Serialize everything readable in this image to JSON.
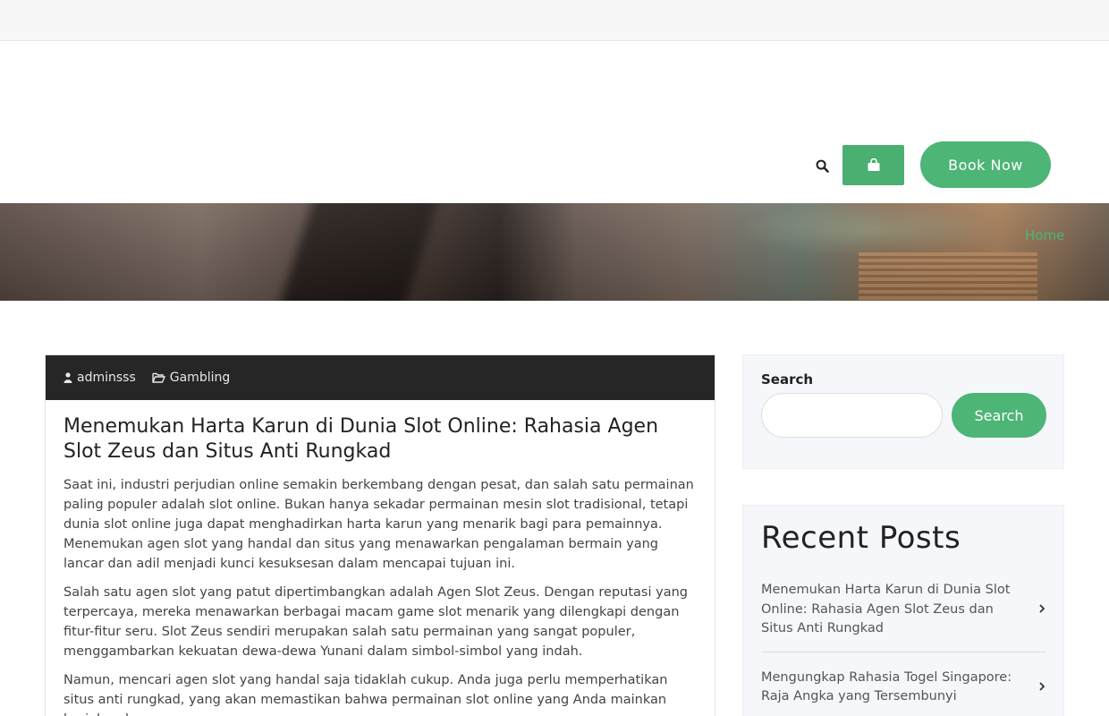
{
  "header": {
    "search_icon": "search-icon",
    "cart_icon": "shopping-bag-icon",
    "book_now_label": "Book Now",
    "accent_color": "#4db576"
  },
  "breadcrumb": {
    "home_label": "Home"
  },
  "post": {
    "author": "adminsss",
    "category": "Gambling",
    "title": "Menemukan Harta Karun di Dunia Slot Online: Rahasia Agen Slot Zeus dan Situs Anti Rungkad",
    "paragraphs": [
      "Saat ini, industri perjudian online semakin berkembang dengan pesat, dan salah satu permainan paling populer adalah slot online. Bukan hanya sekadar permainan mesin slot tradisional, tetapi dunia slot online juga dapat menghadirkan harta karun yang menarik bagi para pemainnya. Menemukan agen slot yang handal dan situs yang menawarkan pengalaman bermain yang lancar dan adil menjadi kunci kesuksesan dalam mencapai tujuan ini.",
      "Salah satu agen slot yang patut dipertimbangkan adalah Agen Slot Zeus. Dengan reputasi yang terpercaya, mereka menawarkan berbagai macam game slot menarik yang dilengkapi dengan fitur-fitur seru. Slot Zeus sendiri merupakan salah satu permainan yang sangat populer, menggambarkan kekuatan dewa-dewa Yunani dalam simbol-simbol yang indah.",
      "Namun, mencari agen slot yang handal saja tidaklah cukup. Anda juga perlu memperhatikan situs anti rungkad, yang akan memastikan bahwa permainan slot online yang Anda mainkan berjalan dengan"
    ]
  },
  "sidebar": {
    "search": {
      "label": "Search",
      "placeholder": "",
      "button_label": "Search"
    },
    "recent": {
      "heading": "Recent Posts",
      "items": [
        {
          "title": "Menemukan Harta Karun di Dunia Slot Online: Rahasia Agen Slot Zeus dan Situs Anti Rungkad"
        },
        {
          "title": "Mengungkap Rahasia Togel Singapore: Raja Angka yang Tersembunyi"
        }
      ]
    }
  }
}
